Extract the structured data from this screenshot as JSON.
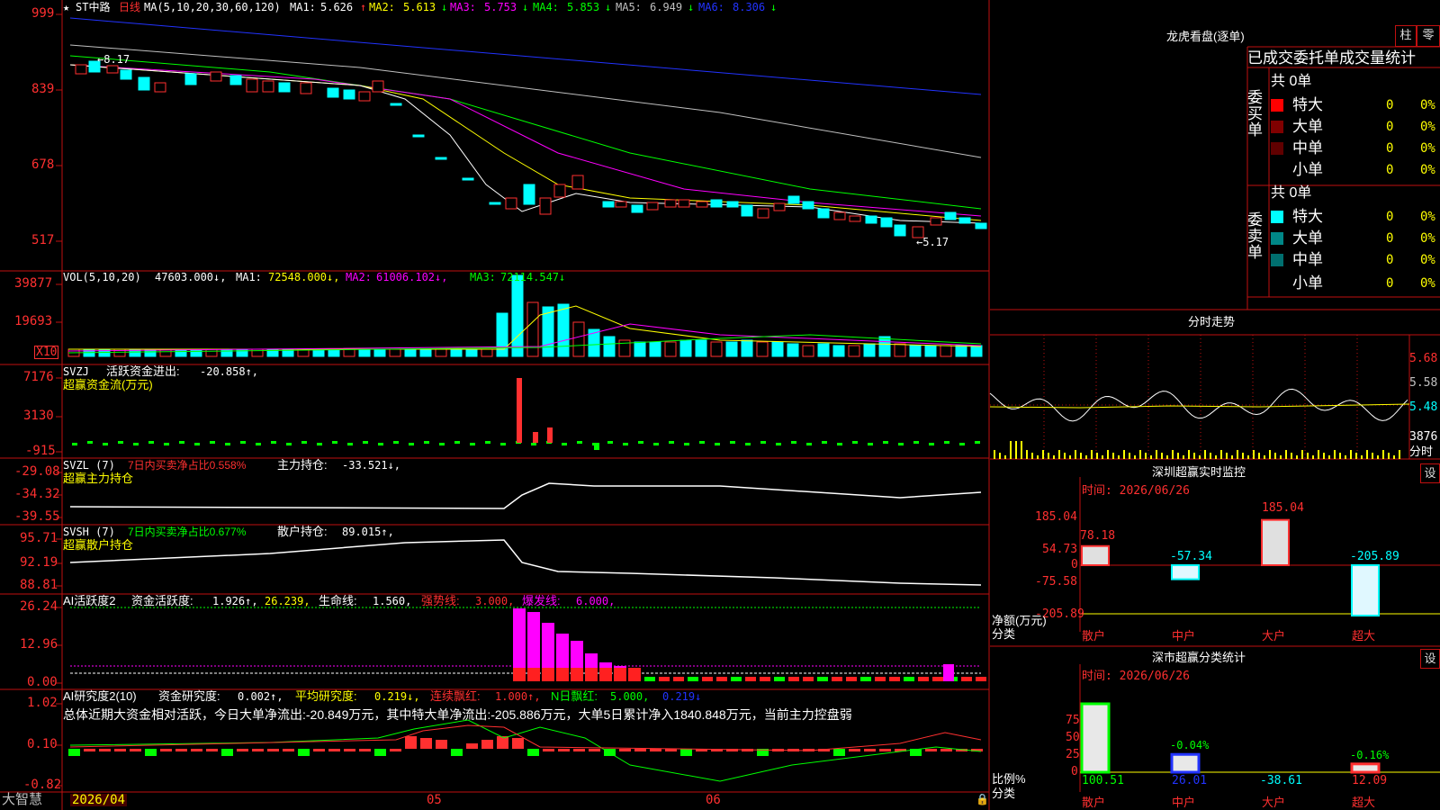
{
  "colors": {
    "up": "#ff3030",
    "down": "#00ffff",
    "ma1": "#ffffff",
    "ma2": "#ffff00",
    "ma3": "#ff00ff",
    "ma4": "#00ff00",
    "ma5": "#c0c0c0",
    "ma6": "#2233ff",
    "grid": "#c01010"
  },
  "left_panel": {
    "price": {
      "star": "★",
      "stock_name": "ST中路",
      "period": "日线",
      "ma_params": "MA(5,10,20,30,60,120)",
      "ma_values": [
        {
          "label": "MA1:",
          "value": "5.626",
          "arrow": "↑"
        },
        {
          "label": "MA2:",
          "value": "5.613",
          "arrow": "↓"
        },
        {
          "label": "MA3:",
          "value": "5.753",
          "arrow": "↓"
        },
        {
          "label": "MA4:",
          "value": "5.853",
          "arrow": "↓"
        },
        {
          "label": "MA5:",
          "value": "6.949",
          "arrow": "↓"
        },
        {
          "label": "MA6:",
          "value": "8.306",
          "arrow": "↓"
        }
      ],
      "y_axis": [
        "999",
        "839",
        "678",
        "517"
      ],
      "high_label": "←8.17",
      "low_label": "←5.17"
    },
    "volume": {
      "label": "VOL(5,10,20)",
      "value": "47603.000↓,",
      "ma": [
        {
          "label": "MA1:",
          "value": "72548.000↓,"
        },
        {
          "label": "MA2:",
          "value": "61006.102↓,"
        },
        {
          "label": "MA3:",
          "value": "72114.547↓"
        }
      ],
      "y_axis": [
        "39877",
        "19693"
      ],
      "unit": "X10"
    },
    "svzj": {
      "label": "SVZJ",
      "title": "活跃资金进出:",
      "value": "-20.858↑,",
      "subtitle": "超赢资金流(万元)",
      "y_axis": [
        "7176",
        "3130",
        "-915"
      ]
    },
    "svzl": {
      "label": "SVZL (7)",
      "ratio": "7日内买卖净占比0.558%",
      "title": "主力持仓:",
      "value": "-33.521↓,",
      "subtitle": "超赢主力持仓",
      "y_axis": [
        "-29.08",
        "-34.32",
        "-39.55"
      ]
    },
    "svsh": {
      "label": "SVSH (7)",
      "ratio": "7日内买卖净占比0.677%",
      "title": "散户持仓:",
      "value": "89.015↑,",
      "subtitle": "超赢散户持仓",
      "y_axis": [
        "95.71",
        "92.19",
        "88.81"
      ]
    },
    "ai_active": {
      "label": "AI活跃度2",
      "t1": "资金活跃度:",
      "v1": "1.926↑,",
      "v2": "26.239,",
      "t3": "生命线:",
      "v3": "1.560,",
      "t4": "强势线:",
      "v4": "3.000,",
      "t5": "爆发线:",
      "v5": "6.000,",
      "y_axis": [
        "26.24",
        "12.96",
        "0.00"
      ]
    },
    "ai_research": {
      "label": "AI研究度2(10)",
      "t1": "资金研究度:",
      "v1": "0.002↑,",
      "t2": "平均研究度:",
      "v2": "0.219↓,",
      "t3": "连续飘红:",
      "v3": "1.000↑,",
      "t4": "N日飘红:",
      "v4": "5.000,",
      "v5": "0.219↓",
      "summary": "总体近期大资金相对活跃，今日大单净流出:-20.849万元，其中特大单净流出:-205.886万元，大单5日累计净入1840.848万元，当前主力控盘弱",
      "y_axis": [
        "1.02",
        "0.10",
        "-0.82"
      ]
    },
    "x_axis": {
      "brand": "大智慧",
      "start": "2026/04",
      "m1": "05",
      "m2": "06"
    }
  },
  "right_panel": {
    "dragon": {
      "title": "龙虎看盘(逐单)",
      "btn1": "柱",
      "btn2": "零",
      "header": "已成交委托单成交量统计",
      "buy": {
        "side": "委买单",
        "total": "共 0单",
        "rows": [
          {
            "name": "特大",
            "n": "0",
            "p": "0%"
          },
          {
            "name": "大单",
            "n": "0",
            "p": "0%"
          },
          {
            "name": "中单",
            "n": "0",
            "p": "0%"
          },
          {
            "name": "小单",
            "n": "0",
            "p": "0%"
          }
        ]
      },
      "sell": {
        "side": "委卖单",
        "total": "共 0单",
        "rows": [
          {
            "name": "特大",
            "n": "0",
            "p": "0%"
          },
          {
            "name": "大单",
            "n": "0",
            "p": "0%"
          },
          {
            "name": "中单",
            "n": "0",
            "p": "0%"
          },
          {
            "name": "小单",
            "n": "0",
            "p": "0%"
          }
        ]
      }
    },
    "intraday": {
      "title": "分时走势",
      "prices": [
        "5.68",
        "5.58",
        "5.48"
      ],
      "vol": "3876",
      "vol_label": "分时"
    },
    "monitor": {
      "title": "深圳超赢实时监控",
      "btn": "设",
      "time": "时间: 2026/06/26",
      "y_axis": [
        "185.04",
        "54.73",
        "0",
        "-75.58",
        "-205.89"
      ],
      "y_title": "净额(万元)",
      "x_title": "分类",
      "categories": [
        "散户",
        "中户",
        "大户",
        "超大"
      ],
      "values": [
        78.18,
        -57.34,
        185.04,
        -205.89
      ],
      "value_labels": [
        "78.18",
        "-57.34",
        "185.04",
        "-205.89"
      ]
    },
    "classify": {
      "title": "深市超赢分类统计",
      "btn": "设",
      "time": "时间: 2026/06/26",
      "y_axis": [
        "75",
        "50",
        "25",
        "0"
      ],
      "y_title": "比例%",
      "x_title": "分类",
      "categories": [
        "散户",
        "中户",
        "大户",
        "超大"
      ],
      "pct": [
        100.51,
        26.01,
        -38.61,
        12.09
      ],
      "pct_labels": [
        "100.51",
        "26.01",
        "-38.61",
        "12.09"
      ],
      "small_labels": [
        "",
        "-0.04%",
        "",
        "-0.16%"
      ]
    }
  }
}
